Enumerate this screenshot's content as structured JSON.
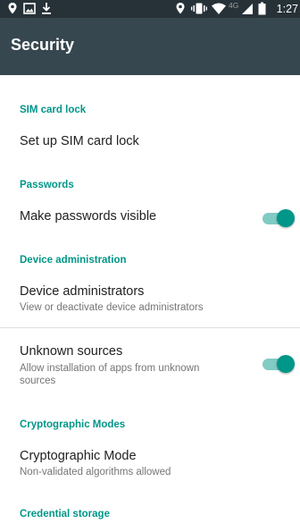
{
  "status_bar": {
    "time": "1:27",
    "left_icons": [
      "location-icon",
      "image-icon",
      "download-icon"
    ],
    "right_icons": [
      "location-icon",
      "vibrate-icon",
      "wifi-icon",
      "network-4g-icon",
      "signal-icon",
      "battery-icon"
    ],
    "network_label": "4G"
  },
  "app_bar": {
    "title": "Security",
    "background": "#37474F"
  },
  "colors": {
    "accent": "#009688",
    "switch_track": "#80CBC4",
    "status_bar": "#263238"
  },
  "sections": [
    {
      "category": "SIM card lock",
      "items": [
        {
          "title": "Set up SIM card lock"
        }
      ]
    },
    {
      "category": "Passwords",
      "items": [
        {
          "title": "Make passwords visible",
          "toggle": true
        }
      ]
    },
    {
      "category": "Device administration",
      "items": [
        {
          "title": "Device administrators",
          "summary": "View or deactivate device administrators"
        },
        {
          "title": "Unknown sources",
          "summary_line1": "Allow installation of apps from unknown",
          "summary_line2": "sources",
          "toggle": true
        }
      ]
    },
    {
      "category": "Cryptographic Modes",
      "items": [
        {
          "title": "Cryptographic Mode",
          "summary": "Non-validated algorithms allowed"
        }
      ]
    },
    {
      "category": "Credential storage",
      "items": []
    }
  ]
}
